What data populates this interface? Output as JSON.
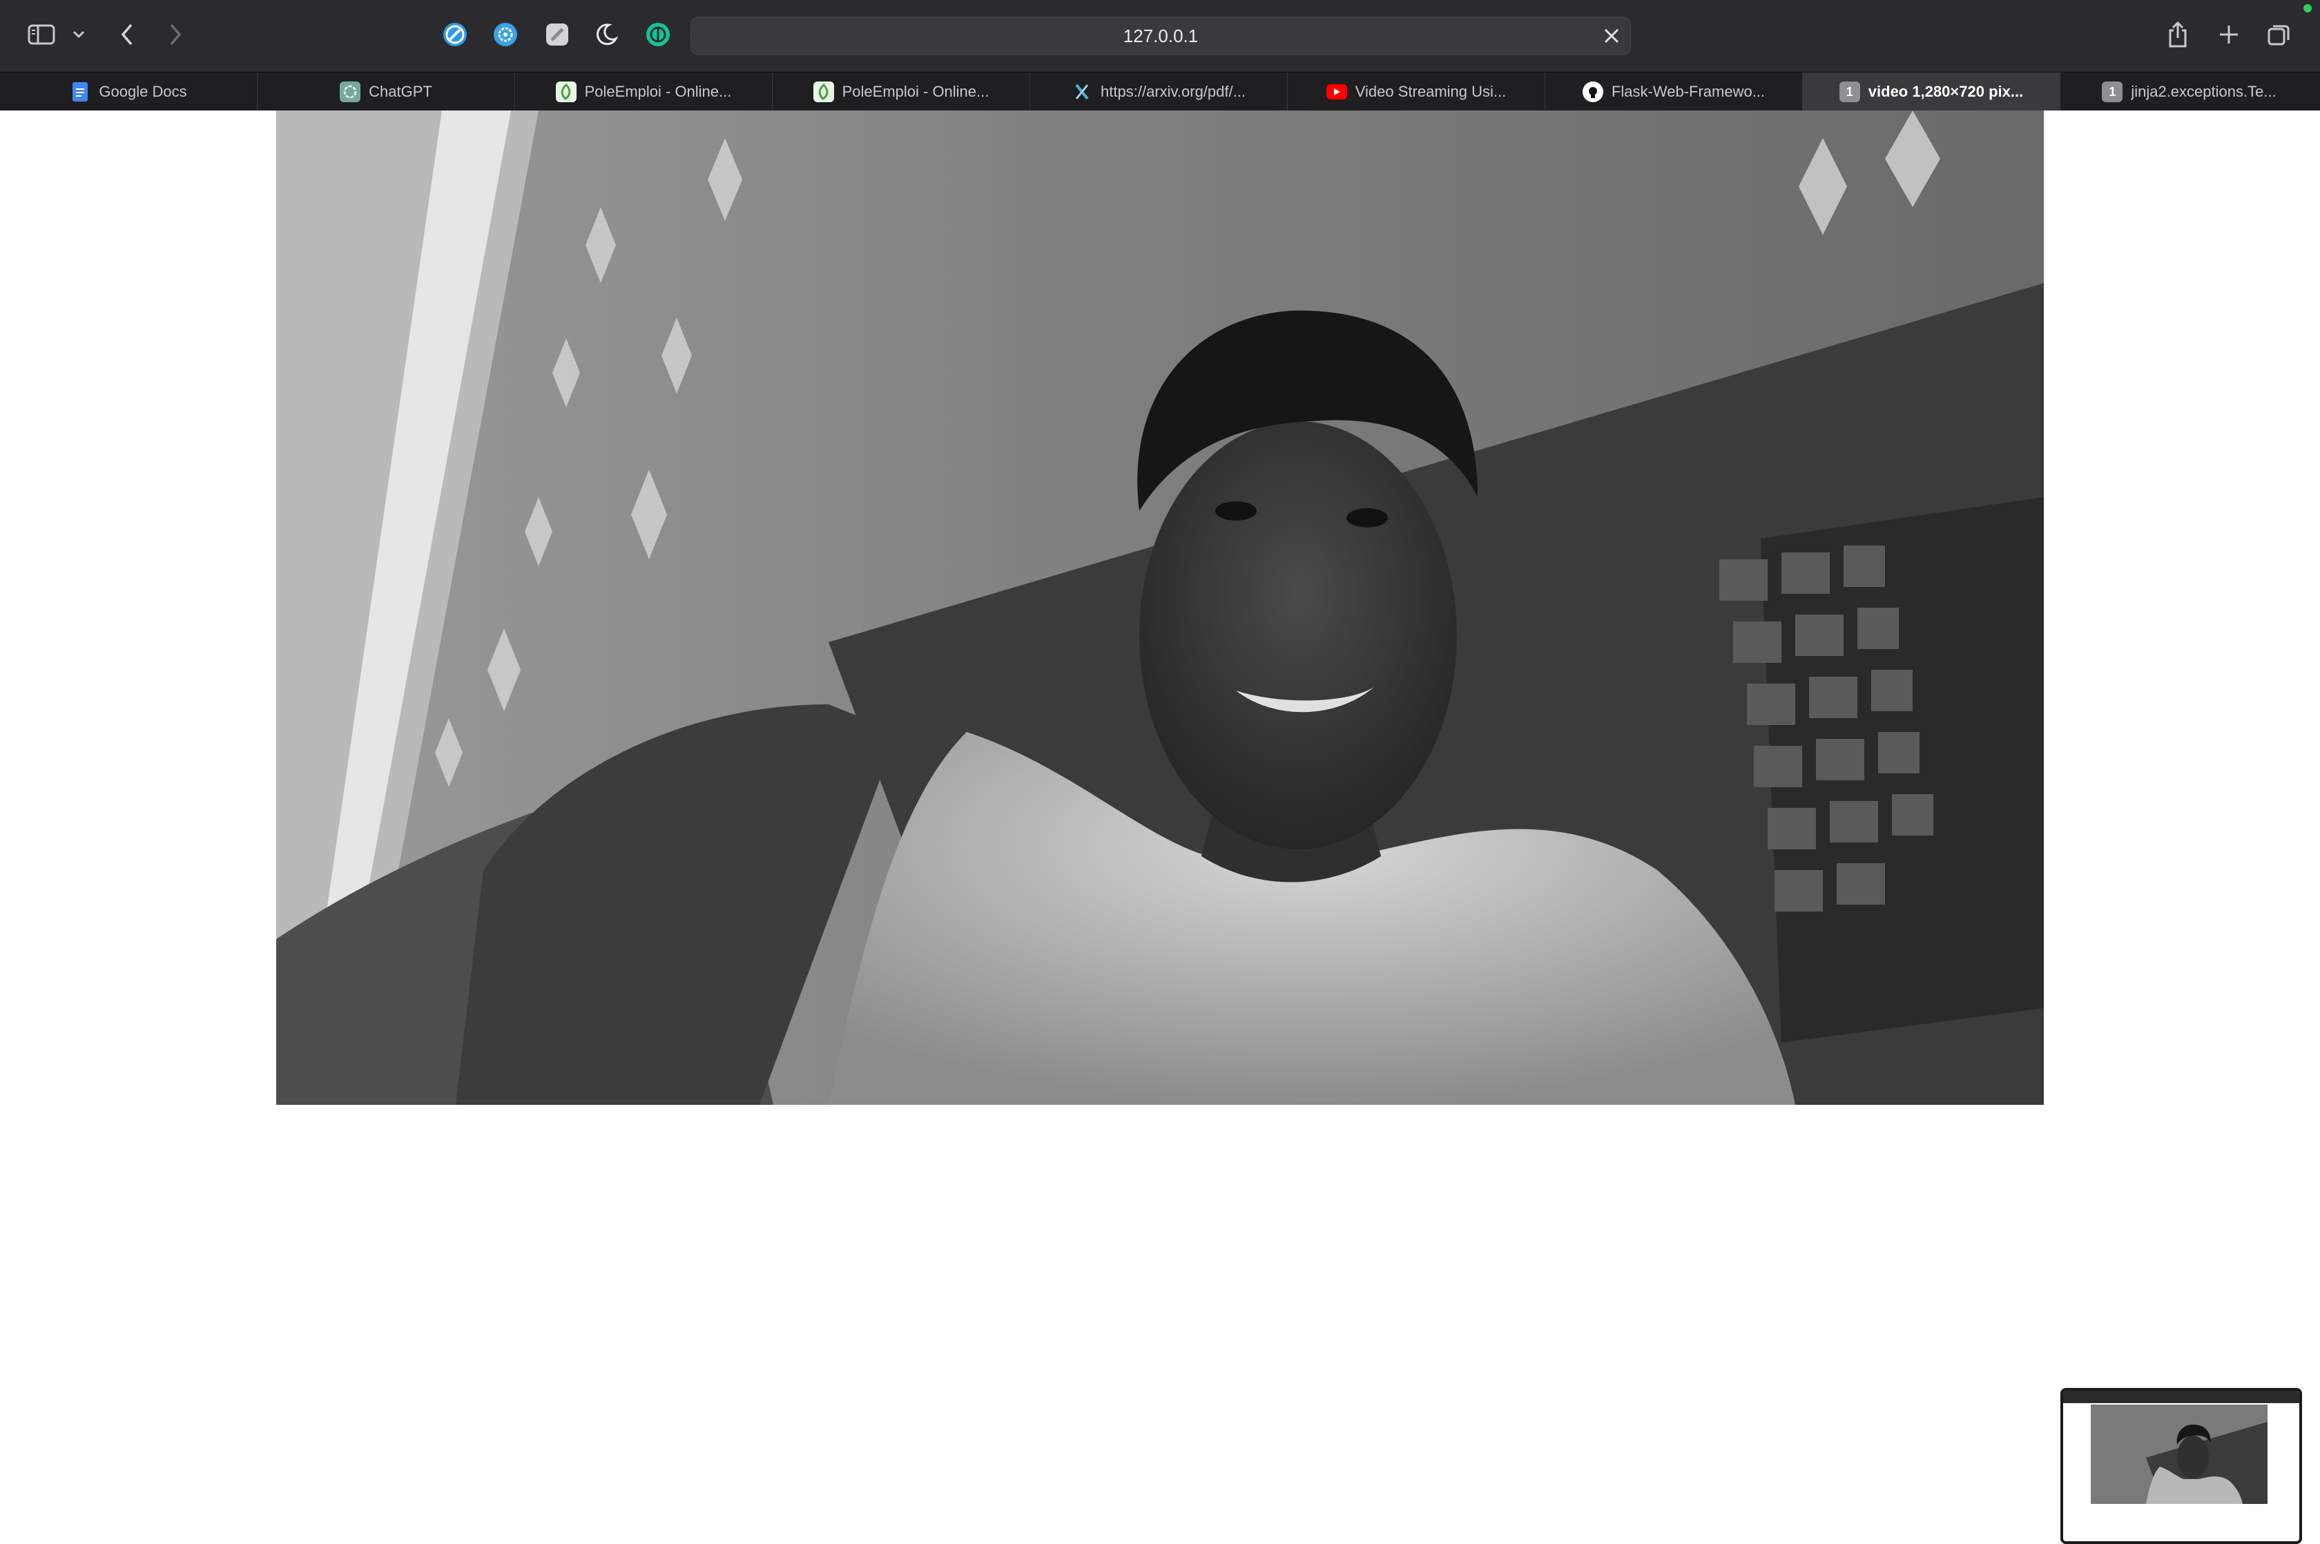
{
  "browser": {
    "address": "127.0.0.1",
    "tabs": [
      {
        "label": "Google Docs",
        "icon": "google-docs-icon",
        "color": "#4285f4",
        "active": false
      },
      {
        "label": "ChatGPT",
        "icon": "chatgpt-icon",
        "color": "#74aa9c",
        "active": false
      },
      {
        "label": "PoleEmploi - Online...",
        "icon": "overleaf-icon",
        "color": "#47a141",
        "active": false
      },
      {
        "label": "PoleEmploi - Online...",
        "icon": "overleaf-icon",
        "color": "#47a141",
        "active": false
      },
      {
        "label": "https://arxiv.org/pdf/...",
        "icon": "arxiv-icon",
        "color": "#4fb1d9",
        "active": false
      },
      {
        "label": "Video Streaming Usi...",
        "icon": "youtube-icon",
        "color": "#ff0000",
        "active": false
      },
      {
        "label": "Flask-Web-Framewo...",
        "icon": "github-icon",
        "color": "#ffffff",
        "active": false
      },
      {
        "label": "video 1,280×720 pix...",
        "icon": "tab-number-icon",
        "badge": "1",
        "color": "#8e8e93",
        "active": true
      },
      {
        "label": "jinja2.exceptions.Te...",
        "icon": "tab-number-icon",
        "badge": "1",
        "color": "#8e8e93",
        "active": false
      }
    ]
  },
  "content": {
    "video": {
      "resolution": "1,280×720"
    }
  },
  "colors": {
    "toolbar": "#2b2b2d",
    "tabbar": "#1f1f21",
    "active_tab": "#3a3a3d",
    "page_background": "#ffffff"
  }
}
